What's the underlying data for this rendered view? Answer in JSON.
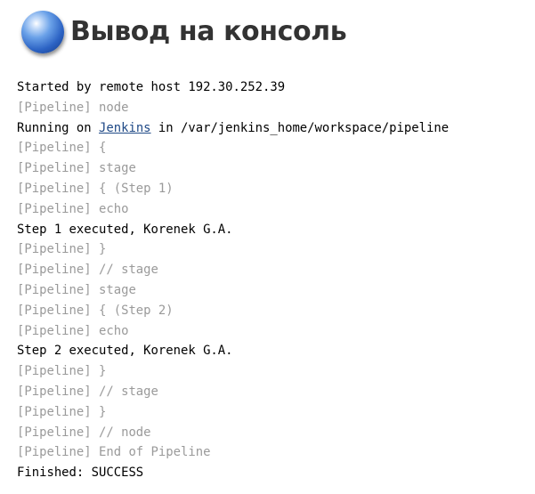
{
  "header": {
    "icon": "blue-ball-icon",
    "title": "Вывод на консоль"
  },
  "colors": {
    "pipeline_text": "#9a9a9a",
    "normal_text": "#000000",
    "link": "#204a87",
    "title": "#333333"
  },
  "console": {
    "l1": "Started by remote host 192.30.252.39",
    "l2": "[Pipeline] node",
    "l3_prefix": "Running on ",
    "l3_link": "Jenkins",
    "l3_suffix": " in /var/jenkins_home/workspace/pipeline",
    "l4": "[Pipeline] {",
    "l5": "[Pipeline] stage",
    "l6": "[Pipeline] { (Step 1)",
    "l7": "[Pipeline] echo",
    "l8": "Step 1 executed, Korenek G.A.",
    "l9": "[Pipeline] }",
    "l10": "[Pipeline] // stage",
    "l11": "[Pipeline] stage",
    "l12": "[Pipeline] { (Step 2)",
    "l13": "[Pipeline] echo",
    "l14": "Step 2 executed, Korenek G.A.",
    "l15": "[Pipeline] }",
    "l16": "[Pipeline] // stage",
    "l17": "[Pipeline] }",
    "l18": "[Pipeline] // node",
    "l19": "[Pipeline] End of Pipeline",
    "l20": "Finished: SUCCESS"
  }
}
